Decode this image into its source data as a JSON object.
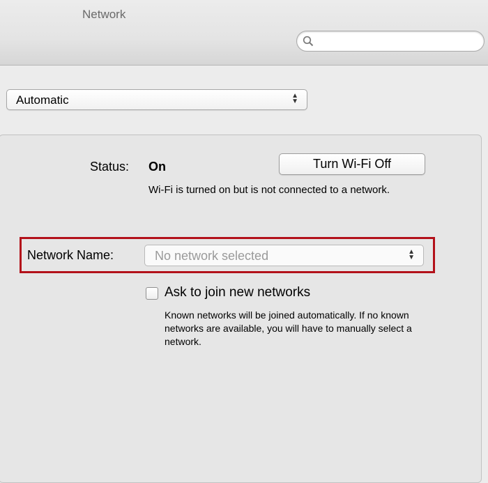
{
  "window": {
    "title": "Network"
  },
  "search": {
    "value": "",
    "placeholder": ""
  },
  "location": {
    "selected": "Automatic"
  },
  "status": {
    "label": "Status:",
    "value": "On",
    "description": "Wi-Fi is turned on but is not connected to a network."
  },
  "wifi_button": {
    "label": "Turn Wi-Fi Off"
  },
  "network_name": {
    "label": "Network Name:",
    "selected": "No network selected"
  },
  "ask_join": {
    "label": "Ask to join new networks",
    "checked": false,
    "help": "Known networks will be joined automatically. If no known networks are available, you will have to manually select a network."
  },
  "icons": {
    "search": "search-icon",
    "popup_arrows": "up-down-arrows-icon"
  },
  "colors": {
    "highlight": "#b3111a",
    "placeholder": "#9a9a9a"
  }
}
